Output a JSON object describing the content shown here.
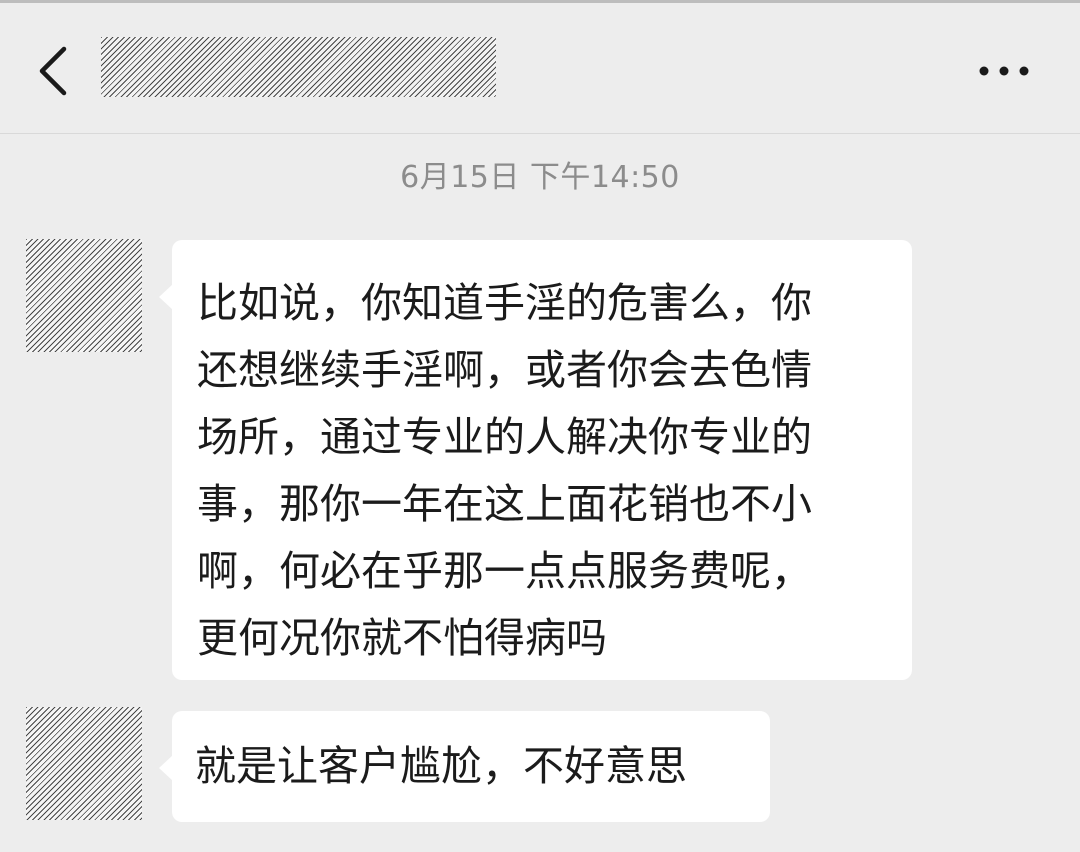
{
  "header": {
    "back_icon": "chevron-left-icon",
    "title_redacted": true,
    "more_icon": "more-horizontal-icon"
  },
  "chat": {
    "timestamp": "6月15日 下午14:50",
    "messages": [
      {
        "avatar_redacted": true,
        "lines": [
          "比如说，你知道手淫的危害么，你",
          "还想继续手淫啊，或者你会去色情",
          "场所，通过专业的人解决你专业的",
          "事，那你一年在这上面花销也不小",
          "啊，何必在乎那一点点服务费呢，",
          "更何况你就不怕得病吗"
        ]
      },
      {
        "avatar_redacted": true,
        "lines": [
          "就是让客户尴尬，不好意思"
        ]
      }
    ]
  },
  "colors": {
    "background": "#ededed",
    "bubble": "#ffffff",
    "text": "#1b1b1b",
    "timestamp": "#8c8c8c"
  }
}
